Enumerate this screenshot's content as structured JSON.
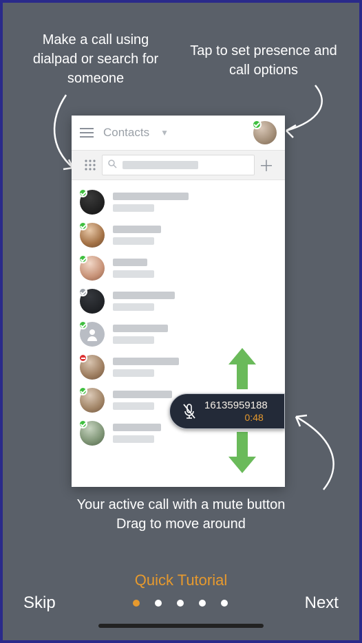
{
  "tips": {
    "top_left": "Make a call using dialpad or search for someone",
    "top_right": "Tap to set presence and call options",
    "bottom": "Your active call with a mute button\nDrag to move around"
  },
  "header": {
    "title": "Contacts"
  },
  "contacts": [
    {
      "status": "online",
      "type": "photo",
      "line_w": 110
    },
    {
      "status": "online",
      "type": "photo",
      "line_w": 70
    },
    {
      "status": "online",
      "type": "photo",
      "line_w": 50
    },
    {
      "status": "offline",
      "type": "photo",
      "line_w": 90
    },
    {
      "status": "online",
      "type": "icon",
      "line_w": 80
    },
    {
      "status": "dnd",
      "type": "photo",
      "line_w": 96
    },
    {
      "status": "online",
      "type": "photo",
      "line_w": 86
    },
    {
      "status": "online",
      "type": "photo",
      "line_w": 70
    }
  ],
  "active_call": {
    "number": "16135959188",
    "time": "0:48"
  },
  "footer": {
    "title": "Quick Tutorial",
    "skip": "Skip",
    "next": "Next",
    "total_dots": 5,
    "active_dot": 0
  }
}
